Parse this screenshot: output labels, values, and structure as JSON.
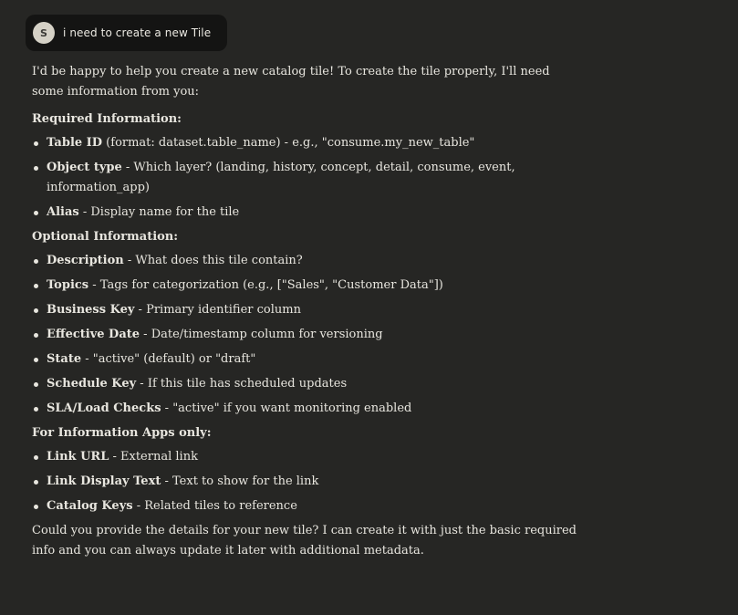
{
  "user_message": {
    "avatar_initial": "S",
    "text": "i need to create a new Tile"
  },
  "response": {
    "intro": "I'd be happy to help you create a new catalog tile! To create the tile properly, I'll need some information from you:",
    "sections": [
      {
        "heading": "Required Information:",
        "items": [
          {
            "term": "Table ID",
            "desc": " (format: dataset.table_name) - e.g., \"consume.my_new_table\""
          },
          {
            "term": "Object type",
            "desc": " - Which layer? (landing, history, concept, detail, consume, event, information_app)"
          },
          {
            "term": "Alias",
            "desc": " - Display name for the tile"
          }
        ]
      },
      {
        "heading": "Optional Information:",
        "items": [
          {
            "term": "Description",
            "desc": " - What does this tile contain?"
          },
          {
            "term": "Topics",
            "desc": " - Tags for categorization (e.g., [\"Sales\", \"Customer Data\"])"
          },
          {
            "term": "Business Key",
            "desc": " - Primary identifier column"
          },
          {
            "term": "Effective Date",
            "desc": " - Date/timestamp column for versioning"
          },
          {
            "term": "State",
            "desc": " - \"active\" (default) or \"draft\""
          },
          {
            "term": "Schedule Key",
            "desc": " - If this tile has scheduled updates"
          },
          {
            "term": "SLA/Load Checks",
            "desc": " - \"active\" if you want monitoring enabled"
          }
        ]
      },
      {
        "heading": "For Information Apps only:",
        "items": [
          {
            "term": "Link URL",
            "desc": " - External link"
          },
          {
            "term": "Link Display Text",
            "desc": " - Text to show for the link"
          },
          {
            "term": "Catalog Keys",
            "desc": " - Related tiles to reference"
          }
        ]
      }
    ],
    "closing": "Could you provide the details for your new tile? I can create it with just the basic required info and you can always update it later with additional metadata."
  }
}
